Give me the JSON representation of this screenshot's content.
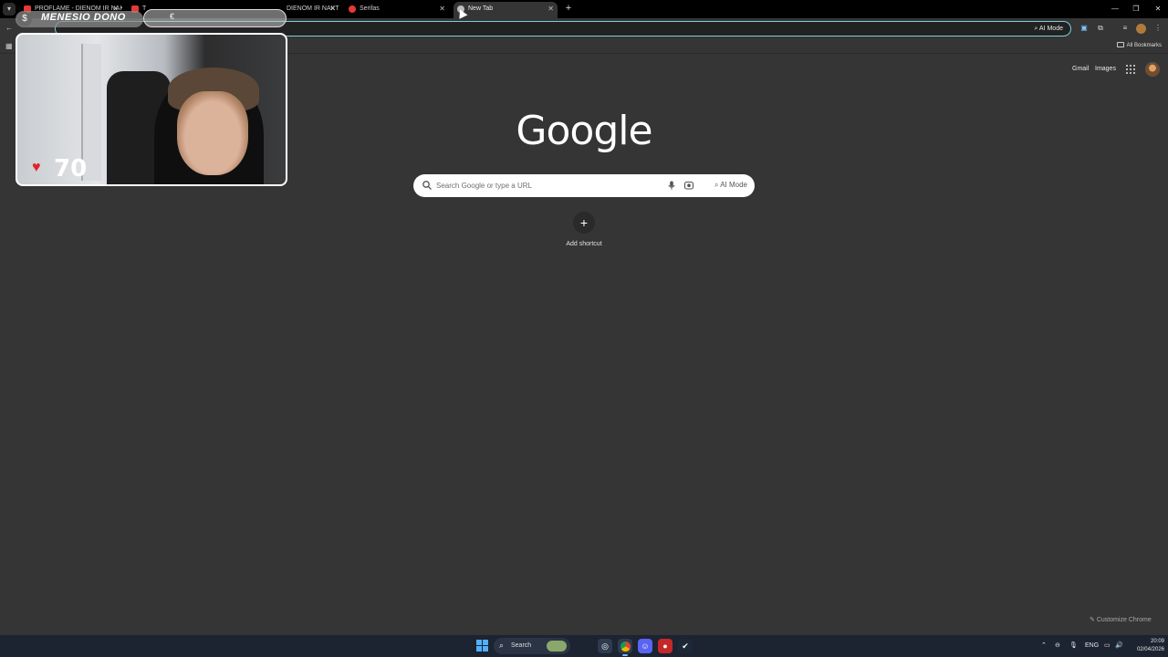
{
  "browser": {
    "tabs": [
      {
        "label": "PROFLAME - DIENOM IR NAKT",
        "favicon_color": "#e53935"
      },
      {
        "label": "T",
        "favicon_color": "#e53935"
      },
      {
        "label": "DIENOM IR NAKT",
        "favicon_color": "#e53935"
      },
      {
        "label": "Serifas",
        "favicon_color": "#e53935"
      },
      {
        "label": "New Tab",
        "favicon_color": "#bdbdbd",
        "active": true
      }
    ],
    "new_tab_glyph": "+",
    "omnibox_ai_mode": "AI Mode",
    "bookmarks": {
      "all_bookmarks_label": "All Bookmarks"
    }
  },
  "ntp": {
    "gmail_link": "Gmail",
    "images_link": "Images",
    "logo_text": "Google",
    "search_placeholder": "Search Google or type a URL",
    "search_ai_mode": "AI Mode",
    "add_shortcut_label": "Add shortcut",
    "add_shortcut_glyph": "+",
    "customize_label": "Customize Chrome"
  },
  "overlay": {
    "donate_label": "MENESIO DONO",
    "donate_coin_glyph": "$",
    "donate_bar_glyph": "€",
    "like_count": "70"
  },
  "taskbar": {
    "search_label": "Search",
    "language": "ENG",
    "time": "20:09",
    "date": "02/04/2026",
    "accent": "#4fb0ff"
  },
  "colors": {
    "page_bg": "#353535",
    "omnibox_border": "#7ccfd6",
    "tab_strip": "#000000"
  }
}
